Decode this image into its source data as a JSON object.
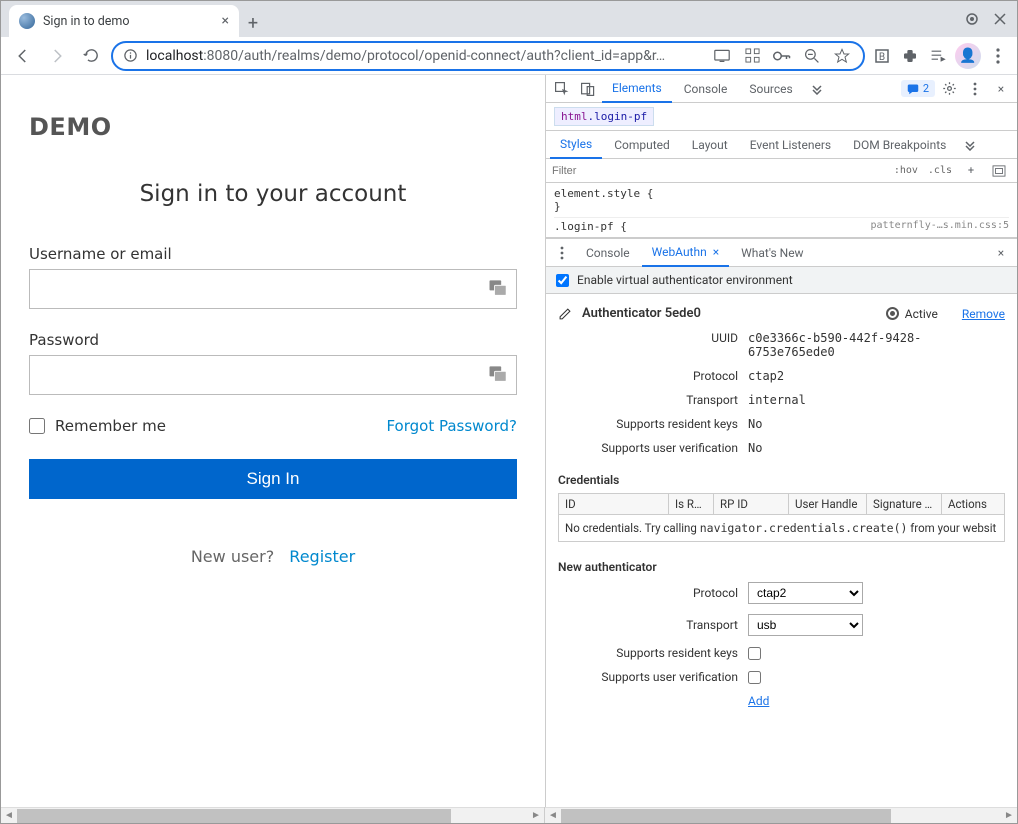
{
  "browser": {
    "tab_title": "Sign in to demo",
    "url_prefix": "localhost",
    "url_rest": ":8080/auth/realms/demo/protocol/openid-connect/auth?client_id=app&r…"
  },
  "page": {
    "brand": "DEMO",
    "title": "Sign in to your account",
    "username_label": "Username or email",
    "password_label": "Password",
    "remember_label": "Remember me",
    "forgot_label": "Forgot Password?",
    "signin_label": "Sign In",
    "newuser_label": "New user?",
    "register_label": "Register"
  },
  "devtools": {
    "tabs": {
      "elements": "Elements",
      "console": "Console",
      "sources": "Sources"
    },
    "issues_count": "2",
    "breadcrumb_tag": "html",
    "breadcrumb_class": ".login-pf",
    "subtabs": {
      "styles": "Styles",
      "computed": "Computed",
      "layout": "Layout",
      "events": "Event Listeners",
      "dom": "DOM Breakpoints"
    },
    "filter_placeholder": "Filter",
    "hov": ":hov",
    "cls": ".cls",
    "elstyle_open": "element.style {",
    "elstyle_close": "}",
    "rule_selector": ".login-pf {",
    "rule_source": "patternfly-…s.min.css:5",
    "drawer_tabs": {
      "console": "Console",
      "webauthn": "WebAuthn",
      "whatsnew": "What's New"
    },
    "enable_label": "Enable virtual authenticator environment",
    "auth": {
      "name": "Authenticator 5ede0",
      "active": "Active",
      "remove": "Remove",
      "uuid_k": "UUID",
      "uuid_v": "c0e3366c-b590-442f-9428-6753e765ede0",
      "proto_k": "Protocol",
      "proto_v": "ctap2",
      "trans_k": "Transport",
      "trans_v": "internal",
      "res_k": "Supports resident keys",
      "res_v": "No",
      "uv_k": "Supports user verification",
      "uv_v": "No"
    },
    "creds": {
      "title": "Credentials",
      "cols": {
        "id": "ID",
        "isres": "Is R…",
        "rpid": "RP ID",
        "uh": "User Handle",
        "sig": "Signature …",
        "act": "Actions"
      },
      "empty_pre": "No credentials. Try calling ",
      "empty_code": "navigator.credentials.create()",
      "empty_post": " from your websit"
    },
    "newauth": {
      "title": "New authenticator",
      "proto_k": "Protocol",
      "proto_v": "ctap2",
      "trans_k": "Transport",
      "trans_v": "usb",
      "res_k": "Supports resident keys",
      "uv_k": "Supports user verification",
      "add": "Add"
    }
  }
}
